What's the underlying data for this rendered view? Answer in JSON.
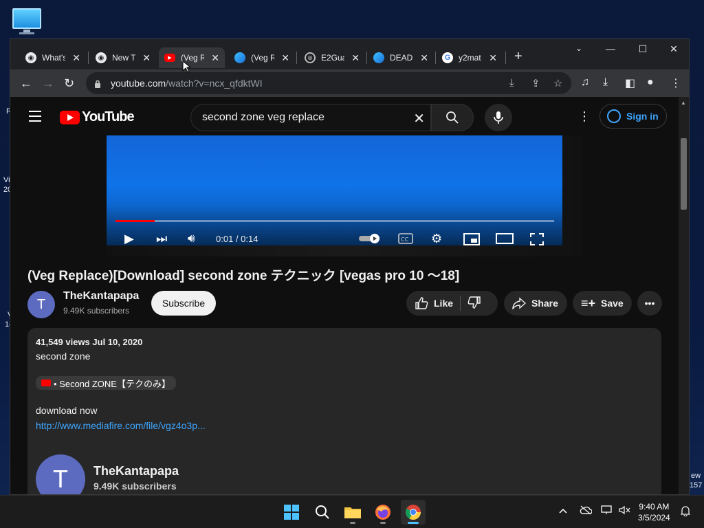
{
  "desktop": {
    "edge_texts": [
      "R",
      "Vi",
      "20",
      "V",
      "14",
      "ew",
      "157"
    ]
  },
  "tabs": [
    {
      "title": "What's",
      "icon": "chrome-icon"
    },
    {
      "title": "New T",
      "icon": "chrome-icon"
    },
    {
      "title": "(Veg R",
      "icon": "youtube-icon",
      "active": true
    },
    {
      "title": "(Veg R",
      "icon": "edge-icon"
    },
    {
      "title": "E2Gua",
      "icon": "globe-icon"
    },
    {
      "title": "DEAD",
      "icon": "edge-icon"
    },
    {
      "title": "y2mat",
      "icon": "google-icon"
    }
  ],
  "toolbar": {
    "url_domain": "youtube.com",
    "url_path": "/watch?v=ncx_qfdktWI"
  },
  "yt": {
    "logo_text": "YouTube",
    "search_value": "second zone veg replace",
    "signin_label": "Sign in",
    "player_time": "0:01 / 0:14",
    "progress_fraction": 0.09,
    "video_title": "(Veg Replace)[Download] second zone テクニック [vegas pro 10 ～18]",
    "channel_avatar_letter": "T",
    "channel_name": "TheKantapapa",
    "channel_subs": "9.49K subscribers",
    "subscribe_label": "Subscribe",
    "like_label": "Like",
    "share_label": "Share",
    "save_label": "Save",
    "desc_meta": "41,549 views  Jul 10, 2020",
    "desc_line1": "second zone",
    "desc_chip": "• Second ZONE【テクのみ】",
    "desc_line2": "download now",
    "desc_link": "http://www.mediafire.com/file/vgz4o3p...",
    "big_channel_name": "TheKantapapa",
    "big_channel_subs": "9.49K subscribers"
  },
  "taskbar": {
    "time": "9:40 AM",
    "date": "3/5/2024"
  },
  "colors": {
    "accent_link": "#3ea6ff",
    "yt_red": "#ff0000"
  }
}
